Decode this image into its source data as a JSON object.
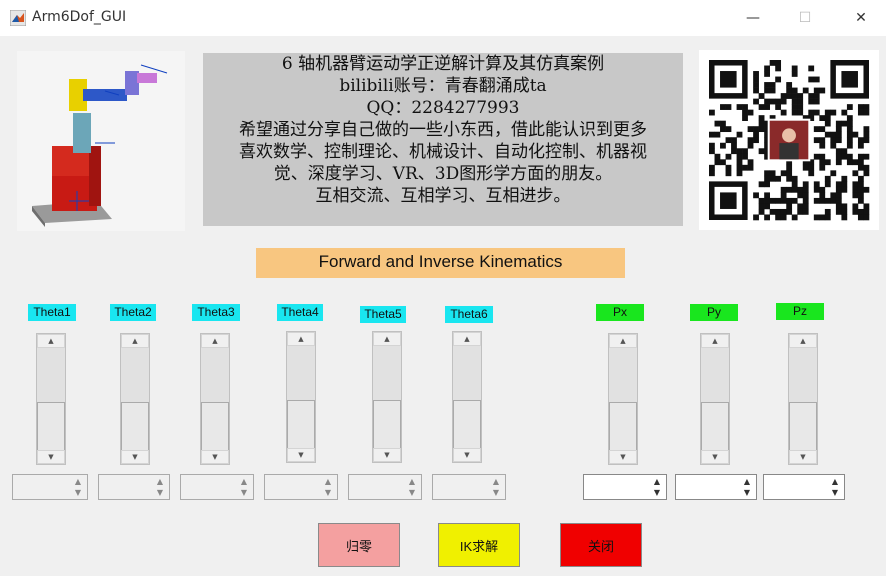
{
  "window": {
    "title": "Arm6Dof_GUI",
    "minimize_glyph": "—",
    "maximize_glyph": "☐",
    "close_glyph": "✕"
  },
  "info": {
    "lines": [
      "6 轴机器臂运动学正逆解计算及其仿真案例",
      "bilibili账号：青春翻涌成ta",
      "QQ：2284277993",
      "希望通过分享自己做的一些小东西，借此能认识到更多",
      "喜欢数学、控制理论、机械设计、自动化控制、机器视",
      "觉、深度学习、VR、3D图形学方面的朋友。",
      "互相交流、互相学习、互相进步。"
    ]
  },
  "fk_header": "Forward and Inverse Kinematics",
  "joints": [
    {
      "label": "Theta1",
      "value": ""
    },
    {
      "label": "Theta2",
      "value": ""
    },
    {
      "label": "Theta3",
      "value": ""
    },
    {
      "label": "Theta4",
      "value": ""
    },
    {
      "label": "Theta5",
      "value": ""
    },
    {
      "label": "Theta6",
      "value": ""
    }
  ],
  "positions": [
    {
      "label": "Px",
      "value": ""
    },
    {
      "label": "Py",
      "value": ""
    },
    {
      "label": "Pz",
      "value": ""
    }
  ],
  "buttons": {
    "home": "归零",
    "ik": "IK求解",
    "close": "关闭"
  },
  "colors": {
    "joint_label_bg": "#19e6f0",
    "pos_label_bg": "#19e61e",
    "header_bg": "#f8c680",
    "home_btn": "#f4a0a0",
    "ik_btn": "#f0f000",
    "close_btn": "#f00000"
  }
}
